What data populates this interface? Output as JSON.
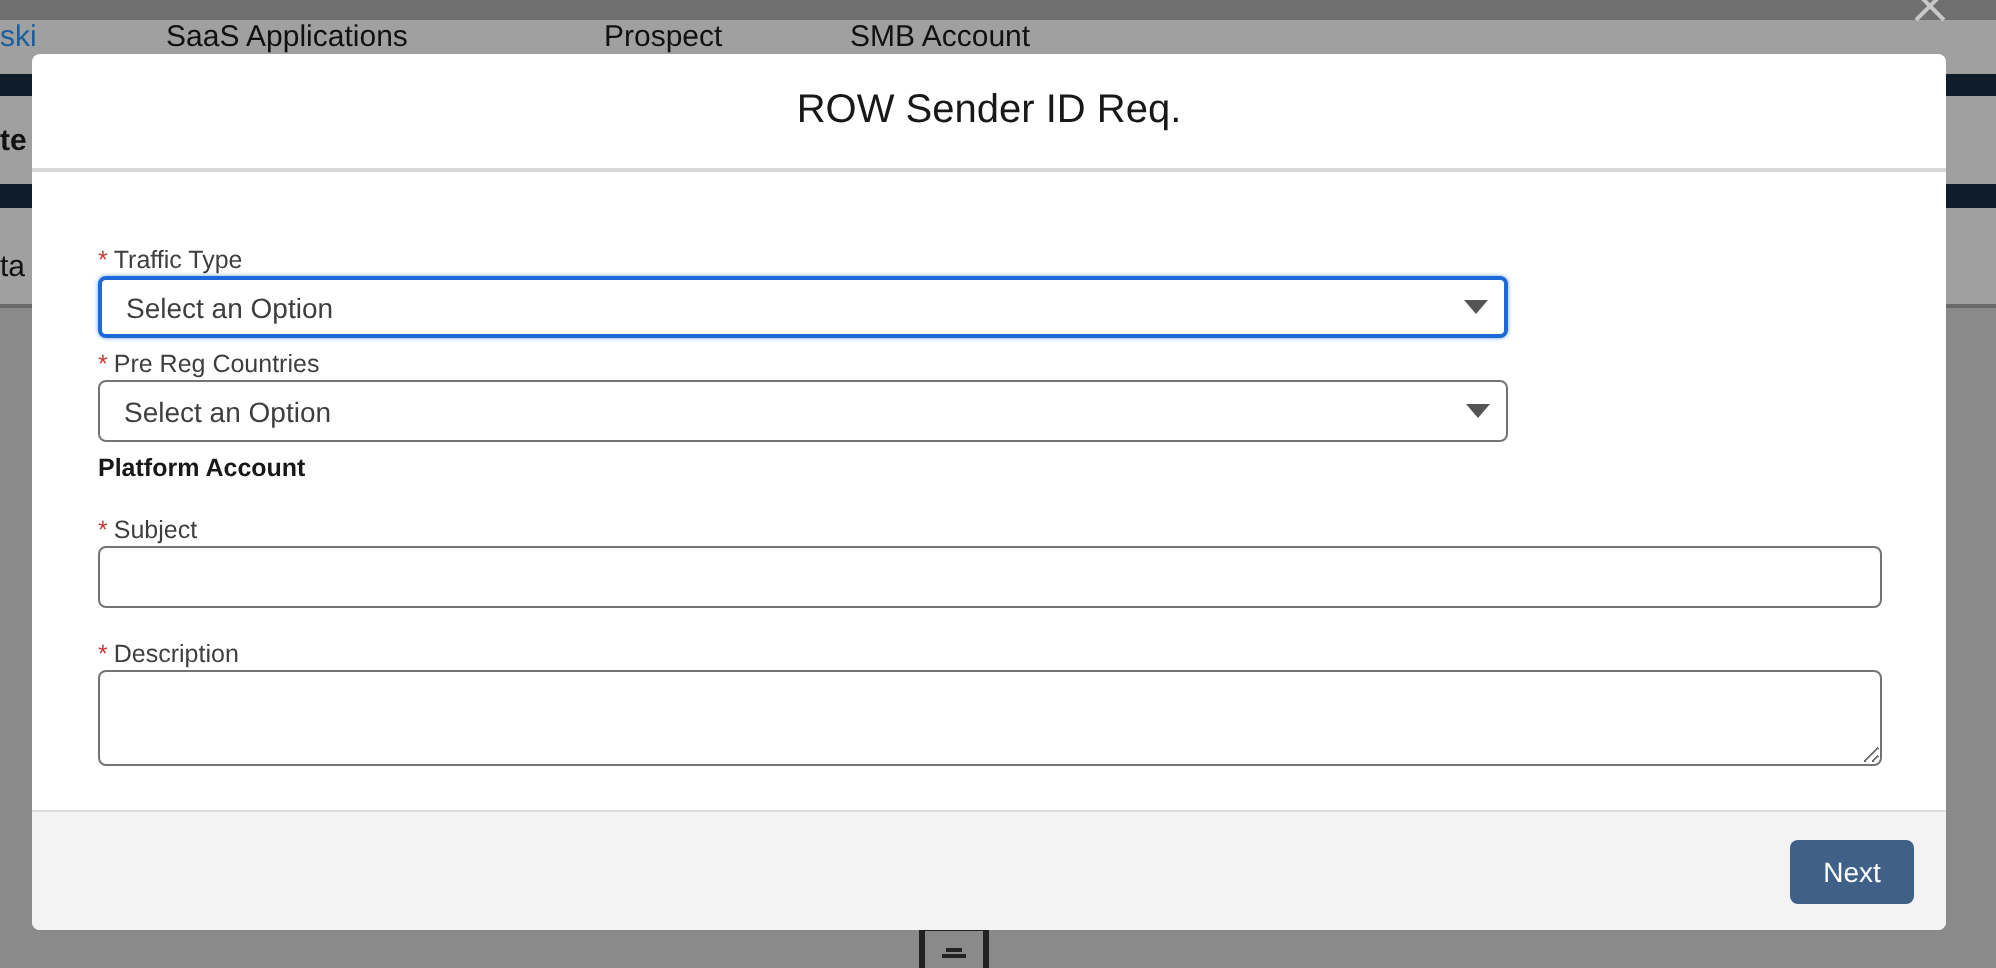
{
  "background": {
    "link": "ski",
    "columns": [
      {
        "value": "SaaS Applications"
      },
      {
        "value": "Prospect"
      },
      {
        "value": "SMB Account"
      }
    ],
    "left_texts": [
      "te",
      "ta"
    ]
  },
  "modal": {
    "title": "ROW Sender ID Req.",
    "required_mark": "*",
    "fields": [
      {
        "kind": "select",
        "label": "Traffic Type",
        "required": true,
        "placeholder": "Select an Option",
        "focused": true
      },
      {
        "kind": "select",
        "label": "Pre Reg Countries",
        "required": true,
        "placeholder": "Select an Option",
        "focused": false
      },
      {
        "kind": "section",
        "label": "Platform Account"
      },
      {
        "kind": "text",
        "label": "Subject",
        "required": true,
        "focused": false
      },
      {
        "kind": "textarea",
        "label": "Description",
        "required": true,
        "focused": false
      }
    ],
    "buttons": [
      "Next"
    ]
  }
}
